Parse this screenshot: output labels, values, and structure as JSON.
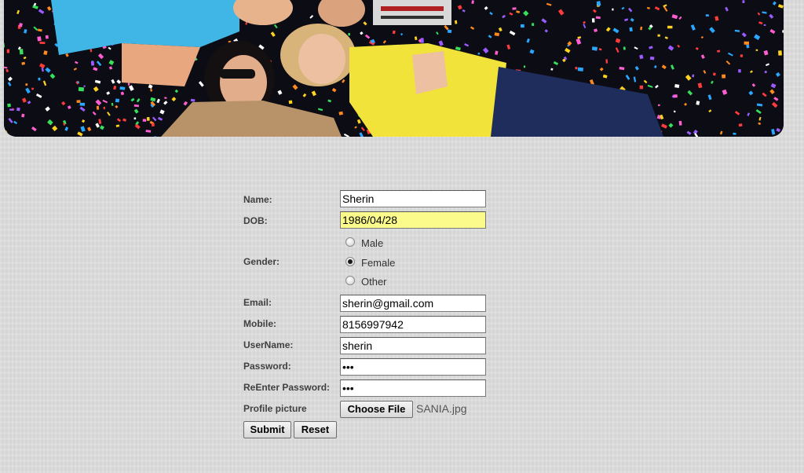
{
  "banner": {
    "image_description": "party photo of people lying on confetti"
  },
  "form": {
    "name": {
      "label": "Name:",
      "value": "Sherin"
    },
    "dob": {
      "label": "DOB:",
      "value": "1986/04/28"
    },
    "gender": {
      "label": "Gender:",
      "options": [
        "Male",
        "Female",
        "Other"
      ],
      "selected": "Female"
    },
    "email": {
      "label": "Email:",
      "value": "sherin@gmail.com"
    },
    "mobile": {
      "label": "Mobile:",
      "value": "8156997942"
    },
    "username": {
      "label": "UserName:",
      "value": "sherin"
    },
    "password": {
      "label": "Password:",
      "value": "•••"
    },
    "reenter_password": {
      "label": "ReEnter Password:",
      "value": "•••"
    },
    "profile_picture": {
      "label": "Profile picture",
      "button_label": "Choose File",
      "file_name": "SANIA.jpg"
    },
    "submit_label": "Submit",
    "reset_label": "Reset"
  },
  "colors": {
    "background": "#dddddd",
    "dob_highlight": "#fbfb8c"
  }
}
